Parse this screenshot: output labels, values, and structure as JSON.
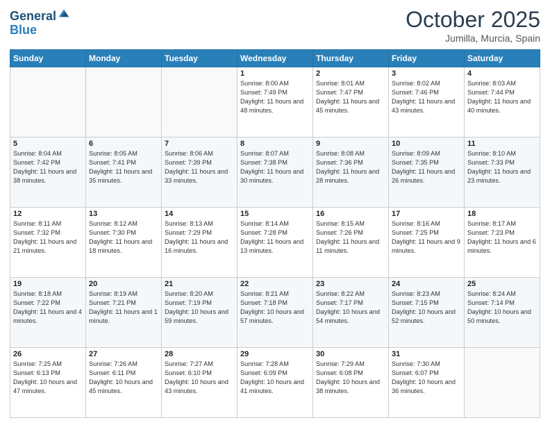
{
  "header": {
    "logo_line1": "General",
    "logo_line2": "Blue",
    "month": "October 2025",
    "location": "Jumilla, Murcia, Spain"
  },
  "weekdays": [
    "Sunday",
    "Monday",
    "Tuesday",
    "Wednesday",
    "Thursday",
    "Friday",
    "Saturday"
  ],
  "weeks": [
    [
      {
        "day": "",
        "sunrise": "",
        "sunset": "",
        "daylight": ""
      },
      {
        "day": "",
        "sunrise": "",
        "sunset": "",
        "daylight": ""
      },
      {
        "day": "",
        "sunrise": "",
        "sunset": "",
        "daylight": ""
      },
      {
        "day": "1",
        "sunrise": "Sunrise: 8:00 AM",
        "sunset": "Sunset: 7:49 PM",
        "daylight": "Daylight: 11 hours and 48 minutes."
      },
      {
        "day": "2",
        "sunrise": "Sunrise: 8:01 AM",
        "sunset": "Sunset: 7:47 PM",
        "daylight": "Daylight: 11 hours and 45 minutes."
      },
      {
        "day": "3",
        "sunrise": "Sunrise: 8:02 AM",
        "sunset": "Sunset: 7:46 PM",
        "daylight": "Daylight: 11 hours and 43 minutes."
      },
      {
        "day": "4",
        "sunrise": "Sunrise: 8:03 AM",
        "sunset": "Sunset: 7:44 PM",
        "daylight": "Daylight: 11 hours and 40 minutes."
      }
    ],
    [
      {
        "day": "5",
        "sunrise": "Sunrise: 8:04 AM",
        "sunset": "Sunset: 7:42 PM",
        "daylight": "Daylight: 11 hours and 38 minutes."
      },
      {
        "day": "6",
        "sunrise": "Sunrise: 8:05 AM",
        "sunset": "Sunset: 7:41 PM",
        "daylight": "Daylight: 11 hours and 35 minutes."
      },
      {
        "day": "7",
        "sunrise": "Sunrise: 8:06 AM",
        "sunset": "Sunset: 7:39 PM",
        "daylight": "Daylight: 11 hours and 33 minutes."
      },
      {
        "day": "8",
        "sunrise": "Sunrise: 8:07 AM",
        "sunset": "Sunset: 7:38 PM",
        "daylight": "Daylight: 11 hours and 30 minutes."
      },
      {
        "day": "9",
        "sunrise": "Sunrise: 8:08 AM",
        "sunset": "Sunset: 7:36 PM",
        "daylight": "Daylight: 11 hours and 28 minutes."
      },
      {
        "day": "10",
        "sunrise": "Sunrise: 8:09 AM",
        "sunset": "Sunset: 7:35 PM",
        "daylight": "Daylight: 11 hours and 26 minutes."
      },
      {
        "day": "11",
        "sunrise": "Sunrise: 8:10 AM",
        "sunset": "Sunset: 7:33 PM",
        "daylight": "Daylight: 11 hours and 23 minutes."
      }
    ],
    [
      {
        "day": "12",
        "sunrise": "Sunrise: 8:11 AM",
        "sunset": "Sunset: 7:32 PM",
        "daylight": "Daylight: 11 hours and 21 minutes."
      },
      {
        "day": "13",
        "sunrise": "Sunrise: 8:12 AM",
        "sunset": "Sunset: 7:30 PM",
        "daylight": "Daylight: 11 hours and 18 minutes."
      },
      {
        "day": "14",
        "sunrise": "Sunrise: 8:13 AM",
        "sunset": "Sunset: 7:29 PM",
        "daylight": "Daylight: 11 hours and 16 minutes."
      },
      {
        "day": "15",
        "sunrise": "Sunrise: 8:14 AM",
        "sunset": "Sunset: 7:28 PM",
        "daylight": "Daylight: 11 hours and 13 minutes."
      },
      {
        "day": "16",
        "sunrise": "Sunrise: 8:15 AM",
        "sunset": "Sunset: 7:26 PM",
        "daylight": "Daylight: 11 hours and 11 minutes."
      },
      {
        "day": "17",
        "sunrise": "Sunrise: 8:16 AM",
        "sunset": "Sunset: 7:25 PM",
        "daylight": "Daylight: 11 hours and 9 minutes."
      },
      {
        "day": "18",
        "sunrise": "Sunrise: 8:17 AM",
        "sunset": "Sunset: 7:23 PM",
        "daylight": "Daylight: 11 hours and 6 minutes."
      }
    ],
    [
      {
        "day": "19",
        "sunrise": "Sunrise: 8:18 AM",
        "sunset": "Sunset: 7:22 PM",
        "daylight": "Daylight: 11 hours and 4 minutes."
      },
      {
        "day": "20",
        "sunrise": "Sunrise: 8:19 AM",
        "sunset": "Sunset: 7:21 PM",
        "daylight": "Daylight: 11 hours and 1 minute."
      },
      {
        "day": "21",
        "sunrise": "Sunrise: 8:20 AM",
        "sunset": "Sunset: 7:19 PM",
        "daylight": "Daylight: 10 hours and 59 minutes."
      },
      {
        "day": "22",
        "sunrise": "Sunrise: 8:21 AM",
        "sunset": "Sunset: 7:18 PM",
        "daylight": "Daylight: 10 hours and 57 minutes."
      },
      {
        "day": "23",
        "sunrise": "Sunrise: 8:22 AM",
        "sunset": "Sunset: 7:17 PM",
        "daylight": "Daylight: 10 hours and 54 minutes."
      },
      {
        "day": "24",
        "sunrise": "Sunrise: 8:23 AM",
        "sunset": "Sunset: 7:15 PM",
        "daylight": "Daylight: 10 hours and 52 minutes."
      },
      {
        "day": "25",
        "sunrise": "Sunrise: 8:24 AM",
        "sunset": "Sunset: 7:14 PM",
        "daylight": "Daylight: 10 hours and 50 minutes."
      }
    ],
    [
      {
        "day": "26",
        "sunrise": "Sunrise: 7:25 AM",
        "sunset": "Sunset: 6:13 PM",
        "daylight": "Daylight: 10 hours and 47 minutes."
      },
      {
        "day": "27",
        "sunrise": "Sunrise: 7:26 AM",
        "sunset": "Sunset: 6:11 PM",
        "daylight": "Daylight: 10 hours and 45 minutes."
      },
      {
        "day": "28",
        "sunrise": "Sunrise: 7:27 AM",
        "sunset": "Sunset: 6:10 PM",
        "daylight": "Daylight: 10 hours and 43 minutes."
      },
      {
        "day": "29",
        "sunrise": "Sunrise: 7:28 AM",
        "sunset": "Sunset: 6:09 PM",
        "daylight": "Daylight: 10 hours and 41 minutes."
      },
      {
        "day": "30",
        "sunrise": "Sunrise: 7:29 AM",
        "sunset": "Sunset: 6:08 PM",
        "daylight": "Daylight: 10 hours and 38 minutes."
      },
      {
        "day": "31",
        "sunrise": "Sunrise: 7:30 AM",
        "sunset": "Sunset: 6:07 PM",
        "daylight": "Daylight: 10 hours and 36 minutes."
      },
      {
        "day": "",
        "sunrise": "",
        "sunset": "",
        "daylight": ""
      }
    ]
  ]
}
